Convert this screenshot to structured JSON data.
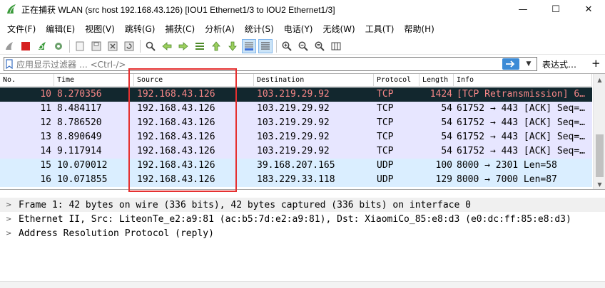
{
  "window": {
    "title": "正在捕获 WLAN (src host 192.168.43.126) [IOU1 Ethernet1/3 to IOU2 Ethernet1/3]",
    "app_icon": "wireshark-fin-icon",
    "controls": {
      "minimize": "—",
      "maximize": "☐",
      "close": "✕"
    }
  },
  "menu": [
    "文件(F)",
    "编辑(E)",
    "视图(V)",
    "跳转(G)",
    "捕获(C)",
    "分析(A)",
    "统计(S)",
    "电话(Y)",
    "无线(W)",
    "工具(T)",
    "帮助(H)"
  ],
  "toolbar": {
    "icons": [
      "start-capture-icon",
      "stop-capture-icon",
      "restart-capture-icon",
      "capture-options-icon",
      "open-file-icon",
      "save-file-icon",
      "close-file-icon",
      "reload-file-icon",
      "find-packet-icon",
      "go-back-icon",
      "go-forward-icon",
      "go-to-packet-icon",
      "go-first-icon",
      "go-last-icon",
      "autoscroll-icon",
      "colorize-icon",
      "zoom-in-icon",
      "zoom-out-icon",
      "zoom-normal-icon",
      "resize-columns-icon"
    ]
  },
  "filter": {
    "placeholder": "应用显示过滤器 … <Ctrl-/>",
    "expression_label": "表达式…",
    "add_label": "+"
  },
  "packet_list": {
    "columns": [
      "No.",
      "Time",
      "Source",
      "Destination",
      "Protocol",
      "Length",
      "Info"
    ],
    "rows": [
      {
        "no": "10",
        "time": "8.270356",
        "source": "192.168.43.126",
        "destination": "103.219.29.92",
        "protocol": "TCP",
        "length": "1424",
        "info": "[TCP Retransmission] 6…",
        "style": "bad"
      },
      {
        "no": "11",
        "time": "8.484117",
        "source": "192.168.43.126",
        "destination": "103.219.29.92",
        "protocol": "TCP",
        "length": "54",
        "info": "61752 → 443 [ACK] Seq=…",
        "style": "tcp"
      },
      {
        "no": "12",
        "time": "8.786520",
        "source": "192.168.43.126",
        "destination": "103.219.29.92",
        "protocol": "TCP",
        "length": "54",
        "info": "61752 → 443 [ACK] Seq=…",
        "style": "tcp"
      },
      {
        "no": "13",
        "time": "8.890649",
        "source": "192.168.43.126",
        "destination": "103.219.29.92",
        "protocol": "TCP",
        "length": "54",
        "info": "61752 → 443 [ACK] Seq=…",
        "style": "tcp"
      },
      {
        "no": "14",
        "time": "9.117914",
        "source": "192.168.43.126",
        "destination": "103.219.29.92",
        "protocol": "TCP",
        "length": "54",
        "info": "61752 → 443 [ACK] Seq=…",
        "style": "tcp"
      },
      {
        "no": "15",
        "time": "10.070012",
        "source": "192.168.43.126",
        "destination": "39.168.207.165",
        "protocol": "UDP",
        "length": "100",
        "info": "8000 → 2301 Len=58",
        "style": "udp"
      },
      {
        "no": "16",
        "time": "10.071855",
        "source": "192.168.43.126",
        "destination": "183.229.33.118",
        "protocol": "UDP",
        "length": "129",
        "info": "8000 → 7000 Len=87",
        "style": "udp"
      }
    ]
  },
  "details": [
    "Frame 1: 42 bytes on wire (336 bits), 42 bytes captured (336 bits) on interface 0",
    "Ethernet II, Src: LiteonTe_e2:a9:81 (ac:b5:7d:e2:a9:81), Dst: XiaomiCo_85:e8:d3 (e0:dc:ff:85:e8:d3)",
    "Address Resolution Protocol (reply)"
  ],
  "colors": {
    "bad_bg": "#12272e",
    "bad_fg": "#f78787",
    "tcp_bg": "#e7e6ff",
    "udp_bg": "#daeeff",
    "highlight": "#e53030"
  }
}
